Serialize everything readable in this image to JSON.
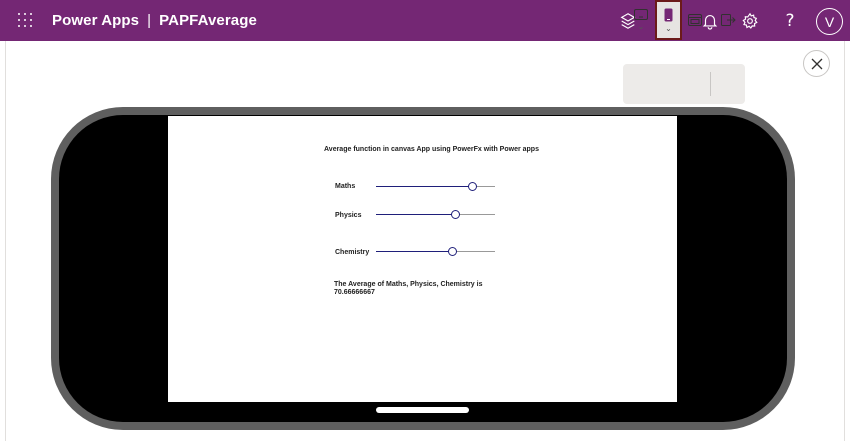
{
  "header": {
    "product": "Power Apps",
    "separator": "|",
    "app_name": "PAPFAverage",
    "help_glyph": "?",
    "avatar_initial": "V",
    "icons": [
      "waffle-icon",
      "environment-icon",
      "copilot-icon",
      "bell-icon",
      "gear-icon",
      "help-icon"
    ]
  },
  "device_toolbar": {
    "icons": [
      "tablet-icon",
      "phone-icon",
      "web-icon",
      "exit-preview-icon"
    ],
    "selected": "phone",
    "chevron": "⌄"
  },
  "canvas": {
    "title": "Average function in canvas App using PowerFx with Power apps",
    "sliders": [
      {
        "label": "Maths",
        "value": 0.81
      },
      {
        "label": "Physics",
        "value": 0.67
      },
      {
        "label": "Chemistry",
        "value": 0.64
      }
    ],
    "result_label": "The Average of Maths, Physics, Chemistry  is",
    "result_value": "70.66666667"
  },
  "colors": {
    "header_bg": "#742774",
    "slider_accent": "#1f1f7a",
    "selected_outline": "#6b1a1a",
    "bezel": "#5f5f5f"
  }
}
